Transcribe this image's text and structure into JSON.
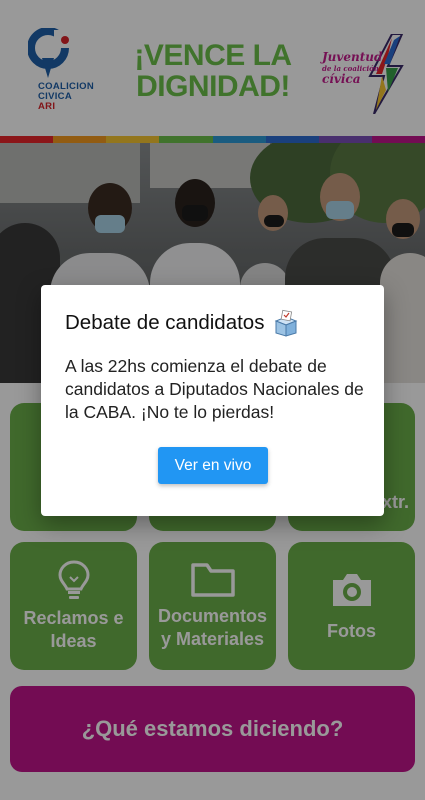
{
  "header": {
    "logo_left": {
      "lines": [
        "COALICION",
        "CIVICA"
      ],
      "accent_line": "ARI"
    },
    "headline": "¡VENCE LA DIGNIDAD!",
    "logo_right": {
      "line1": "Juventud",
      "line2": "de la coalición",
      "line3": "cívica"
    }
  },
  "tiles": [
    {
      "label": "#...",
      "icon": "hashtag-icon",
      "partial": true
    },
    {
      "label": "",
      "icon": "blank-icon",
      "partial": true
    },
    {
      "label": "...xtr.",
      "icon": "blank-icon",
      "partial": true
    },
    {
      "label_line1": "Reclamos e",
      "label_line2": "Ideas",
      "icon": "lightbulb-icon"
    },
    {
      "label_line1": "Documentos",
      "label_line2": "y Materiales",
      "icon": "folder-icon"
    },
    {
      "label_line1": "Fotos",
      "label_line2": "",
      "icon": "camera-icon"
    }
  ],
  "cta": {
    "label": "¿Qué estamos diciendo?"
  },
  "dialog": {
    "title": "Debate de candidatos",
    "title_icon": "ballot-box-icon",
    "body": "A las 22hs comienza el debate de candidatos a Diputados Nacionales de la CABA. ¡No te lo pierdas!",
    "button_label": "Ver en vivo"
  },
  "colors": {
    "tile_green": "#6cb04a",
    "headline_green": "#6cc04a",
    "cta_magenta": "#c0148a",
    "button_blue": "#2196f3",
    "logo_blue": "#1f5fa8",
    "logo_red": "#d9242a"
  }
}
